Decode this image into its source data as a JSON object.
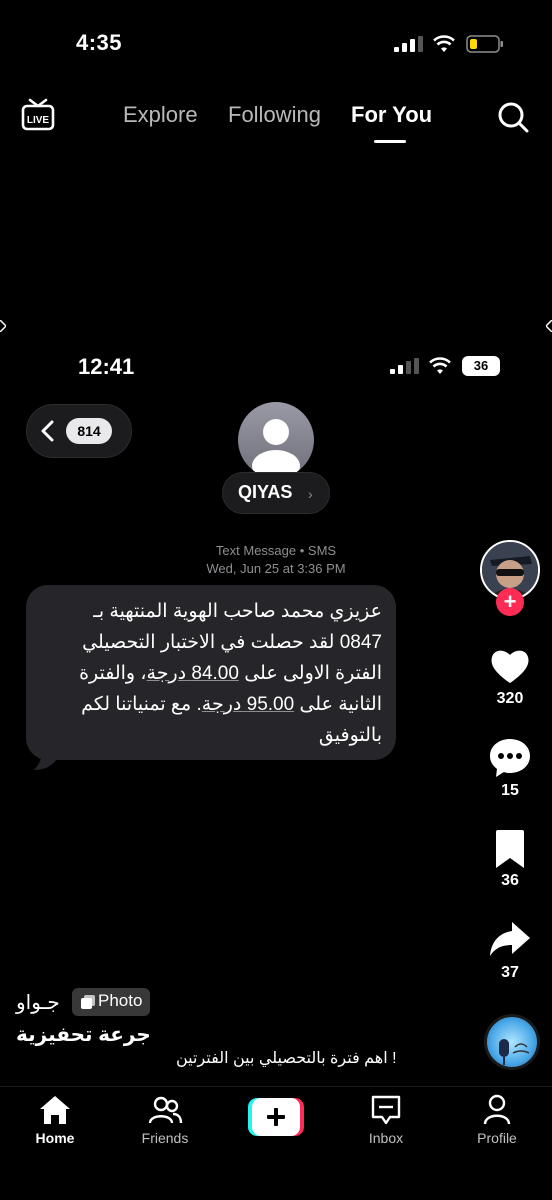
{
  "status_bar": {
    "time": "4:35"
  },
  "top_nav": {
    "tabs": [
      {
        "label": "Explore"
      },
      {
        "label": "Following"
      },
      {
        "label": "For You"
      }
    ],
    "active_tab": "For You"
  },
  "post_image": {
    "status_bar": {
      "time": "12:41",
      "battery": "36"
    },
    "back_count": "814",
    "contact_name": "QIYAS",
    "message_type": "Text Message • SMS",
    "message_time": "Wed, Jun 25 at 3:36 PM",
    "message_text": {
      "line1": "عزيزي محمد صاحب الهوية المنتهية بـ",
      "line2": "0847 لقد حصلت في الاختبار التحصيلي",
      "line3_pre": "الفترة الاولى على ",
      "score1": "84.00 درجة",
      "line3_post": "، والفترة",
      "line4_pre": "الثانية على  ",
      "score2": "95.00 درجة",
      "line4_post": ". مع تمنياتنا لكم",
      "line5": "بالتوفيق"
    }
  },
  "sidebar": {
    "likes": "320",
    "comments": "15",
    "saves": "36",
    "shares": "37"
  },
  "caption": {
    "username": "جـواو",
    "badge": "Photo",
    "title": "جرعة تحفيزية",
    "description": "اهم فترة بالتحصيلي بين الفترتين !"
  },
  "bottom_nav": {
    "home": "Home",
    "friends": "Friends",
    "inbox": "Inbox",
    "profile": "Profile"
  },
  "colors": {
    "background": "#000000",
    "accent_red": "#fe2c55",
    "accent_cyan": "#25f4ee",
    "bubble": "#26262a"
  }
}
